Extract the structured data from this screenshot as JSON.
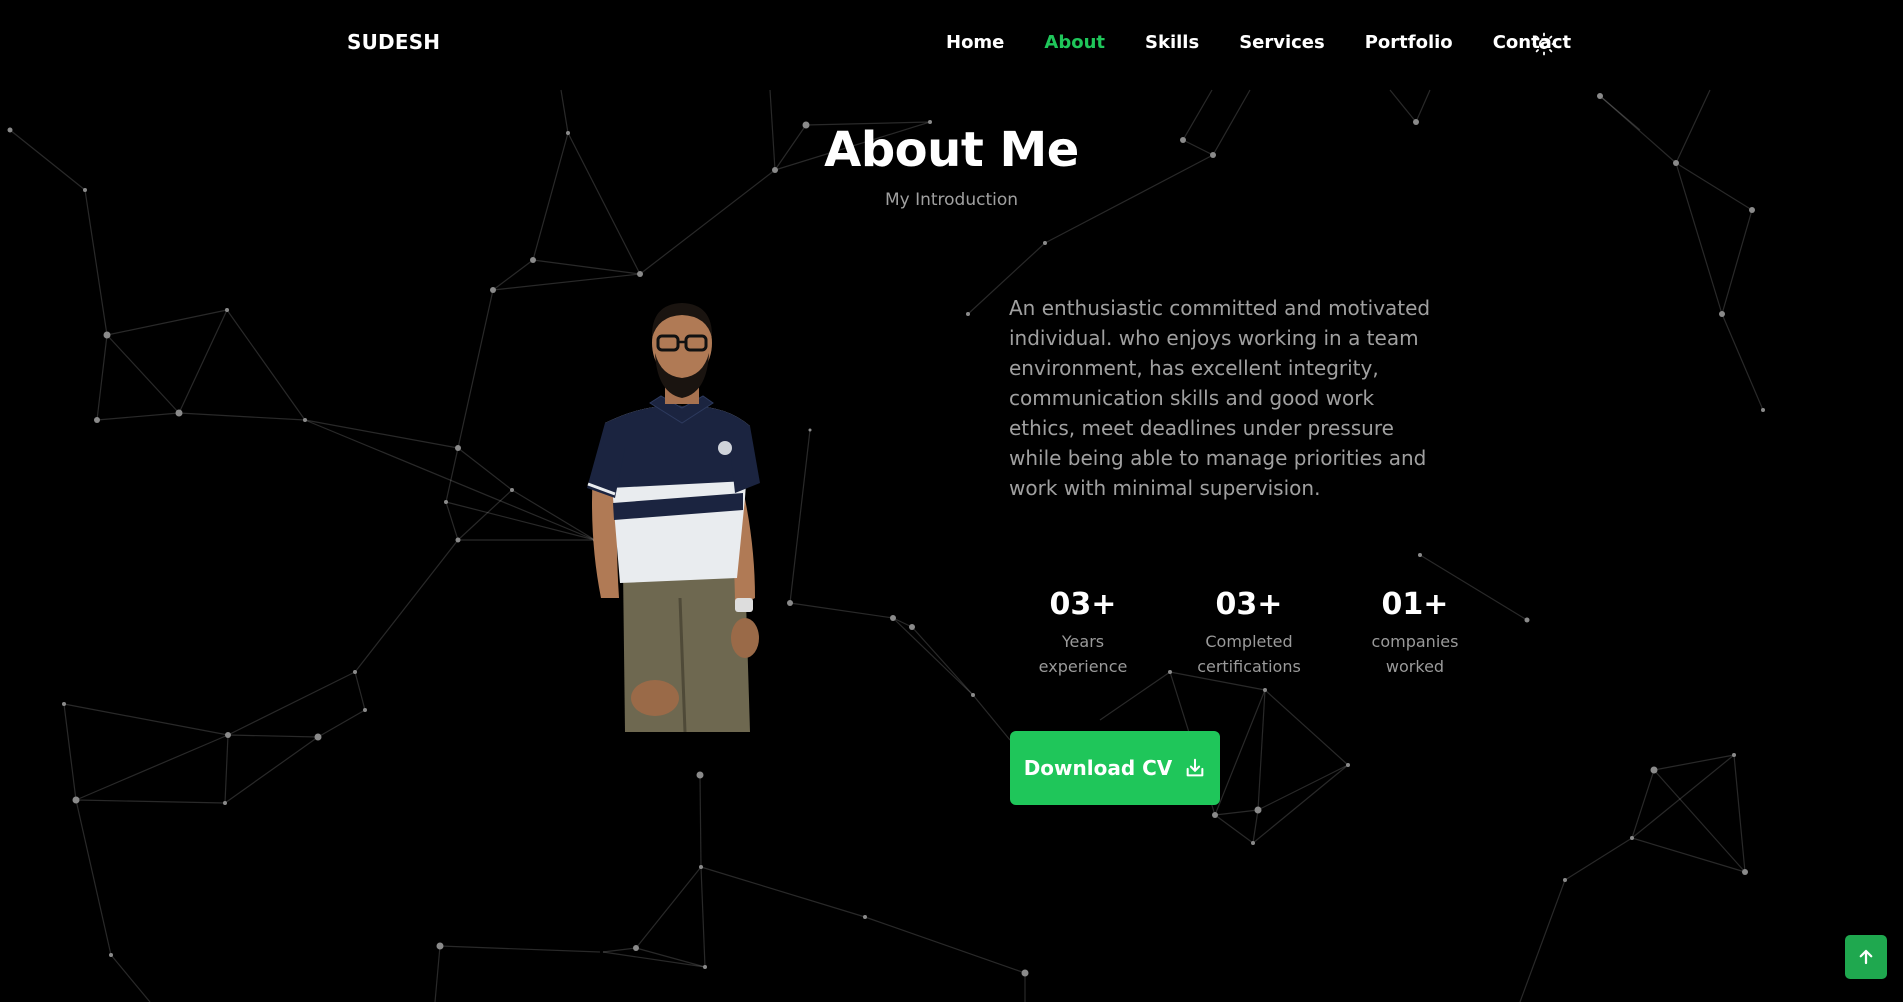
{
  "brand": {
    "logo_text": "SUDESH"
  },
  "nav": {
    "items": [
      "Home",
      "About",
      "Skills",
      "Services",
      "Portfolio",
      "Contact"
    ],
    "active": "About",
    "theme_icon": "sun-icon"
  },
  "about": {
    "title": "About Me",
    "subtitle": "My Introduction",
    "description": "An enthusiastic committed and motivated individual. who enjoys working in a team environment, has excellent integrity, communication skills and good work ethics, meet deadlines under pressure while being able to manage priorities and work with minimal supervision.",
    "stats": [
      {
        "value": "03+",
        "label_line1": "Years",
        "label_line2": "experience"
      },
      {
        "value": "03+",
        "label_line1": "Completed",
        "label_line2": "certifications"
      },
      {
        "value": "01+",
        "label_line1": "companies",
        "label_line2": "worked"
      }
    ],
    "download_label": "Download CV",
    "download_icon": "download-icon"
  },
  "scroll_top_icon": "arrow-up-icon",
  "colors": {
    "accent": "#1fc65a",
    "background": "#000000",
    "muted_text": "#a0a0a0"
  }
}
